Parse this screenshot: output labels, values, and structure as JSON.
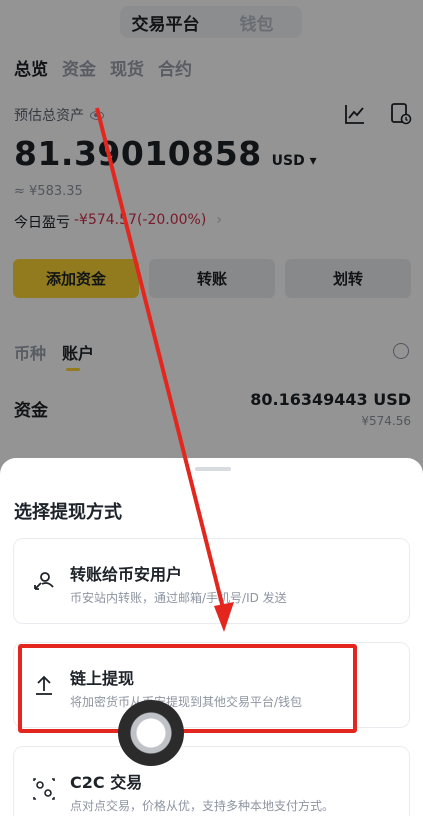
{
  "header": {
    "tab_exchange": "交易平台",
    "tab_wallet": "钱包"
  },
  "nav_tabs": [
    "总览",
    "资金",
    "现货",
    "合约"
  ],
  "assets": {
    "label": "预估总资产",
    "value": "81.39010858",
    "currency": "USD ▾",
    "approx": "≈ ¥583.35",
    "pnl_label": "今日盈亏",
    "pnl_value": "-¥574.57(-20.00%)",
    "pnl_chevron": "›"
  },
  "actions": {
    "deposit": "添加资金",
    "transfer": "转账",
    "move": "划转"
  },
  "sub_tabs": {
    "coin": "币种",
    "account": "账户"
  },
  "fund_row": {
    "name": "资金",
    "amount": "80.16349443 USD",
    "approx": "¥574.56"
  },
  "sheet": {
    "title": "选择提现方式",
    "options": [
      {
        "title": "转账给币安用户",
        "desc": "币安站内转账，通过邮箱/手机号/ID 发送"
      },
      {
        "title": "链上提现",
        "desc": "将加密货币从币安提现到其他交易平台/钱包"
      },
      {
        "title": "C2C 交易",
        "desc": "点对点交易，价格从优，支持多种本地支付方式。"
      }
    ]
  },
  "colors": {
    "accent": "#fcd535",
    "loss": "#cf304a",
    "annotation": "#e3271f"
  }
}
